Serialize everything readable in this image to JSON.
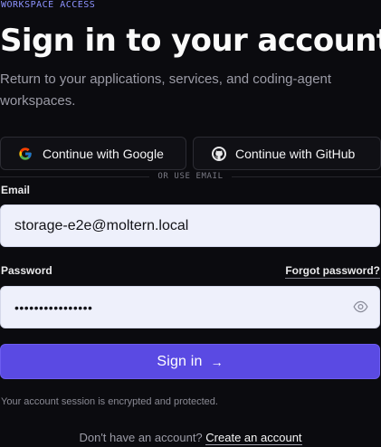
{
  "header": {
    "eyebrow": "WORKSPACE ACCESS",
    "title": "Sign in to your account",
    "subtitle": "Return to your applications, services, and coding-agent workspaces."
  },
  "oauth": {
    "google_label": "Continue with Google",
    "github_label": "Continue with GitHub"
  },
  "divider": {
    "label": "OR USE EMAIL"
  },
  "form": {
    "email_label": "Email",
    "email_value": "storage-e2e@moltern.local",
    "password_label": "Password",
    "forgot_label": "Forgot password?",
    "password_value": "••••••••••••••••",
    "submit_label": "Sign in"
  },
  "note": {
    "secure_text": "Your account session is encrypted and protected."
  },
  "footer": {
    "question": "Don't have an account?",
    "create_link": "Create an account"
  },
  "colors": {
    "accent": "#5a4ae3",
    "eyebrow": "#8d93ff",
    "background": "#0b0b0f"
  },
  "icons": {
    "google": "google-logo-icon",
    "github": "github-logo-icon",
    "eye": "eye-icon",
    "arrow": "arrow-right-icon"
  }
}
